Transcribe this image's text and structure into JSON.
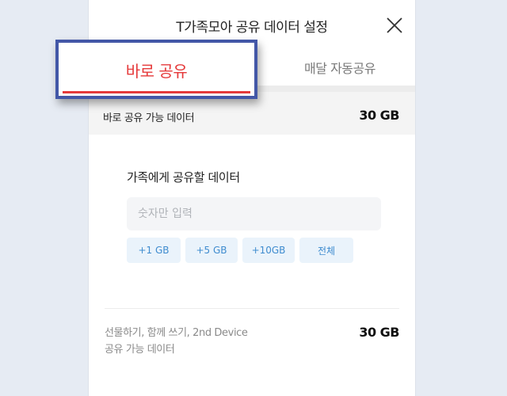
{
  "dialog": {
    "title": "T가족모아 공유 데이터 설정",
    "close_icon": "close-icon"
  },
  "tabs": [
    {
      "label": "바로 공유",
      "active": true
    },
    {
      "label": "매달 자동공유",
      "active": false
    }
  ],
  "available": {
    "label": "바로 공유 가능 데이터",
    "value": "30 GB"
  },
  "share_form": {
    "title": "가족에게 공유할 데이터",
    "input_placeholder": "숫자만 입력",
    "input_value": "",
    "chips": [
      "+1 GB",
      "+5 GB",
      "+10GB",
      "전체"
    ]
  },
  "footer": {
    "label_line1": "선물하기, 함께 쓰기, 2nd Device",
    "label_line2": "공유 가능 데이터",
    "value": "30 GB"
  },
  "colors": {
    "accent_red": "#e5393a",
    "highlight_border": "#4357a7",
    "chip_text": "#3f8ccf",
    "chip_bg": "#eaf3fb"
  }
}
